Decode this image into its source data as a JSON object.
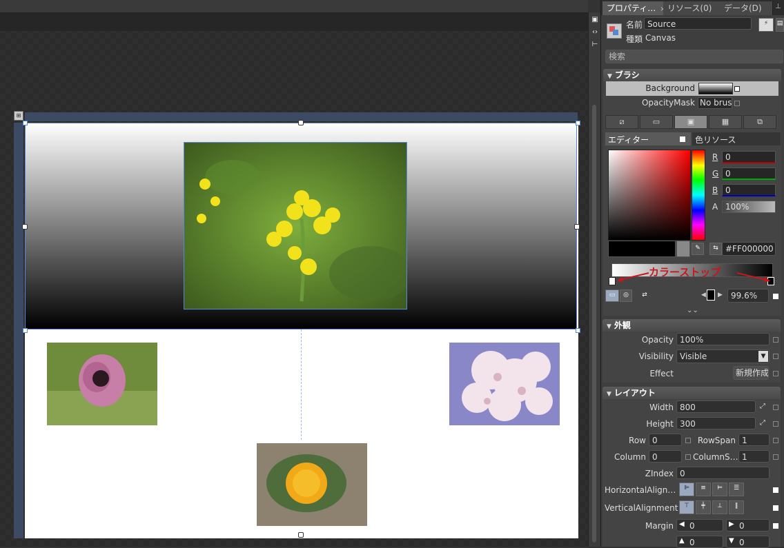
{
  "tabs": [
    {
      "label": "プロパティ…",
      "close": "×",
      "active": true
    },
    {
      "label": "リソース(0)",
      "active": false
    },
    {
      "label": "データ(D)",
      "active": false
    }
  ],
  "element": {
    "name_label": "名前",
    "name_value": "Source",
    "type_label": "種類",
    "type_value": "Canvas"
  },
  "search": {
    "placeholder": "検索"
  },
  "brush": {
    "section_title": "ブラシ",
    "background_label": "Background",
    "opacitymask_label": "OpacityMask",
    "opacitymask_value": "No brush",
    "editor_tab": "エディター",
    "color_resources_tab": "色リソース",
    "r_label": "R",
    "r_value": "0",
    "g_label": "G",
    "g_value": "0",
    "b_label": "B",
    "b_value": "0",
    "a_label": "A",
    "a_value": "100%",
    "hex_value": "#FF000000",
    "stop_offset": "99.6%",
    "annotation": "カラーストップ"
  },
  "appearance": {
    "section_title": "外観",
    "opacity_label": "Opacity",
    "opacity_value": "100%",
    "visibility_label": "Visibility",
    "visibility_value": "Visible",
    "effect_label": "Effect",
    "effect_button": "新規作成"
  },
  "layout": {
    "section_title": "レイアウト",
    "width_label": "Width",
    "width_value": "800",
    "height_label": "Height",
    "height_value": "300",
    "row_label": "Row",
    "row_value": "0",
    "rowspan_label": "RowSpan",
    "rowspan_value": "1",
    "column_label": "Column",
    "column_value": "0",
    "columnspan_label": "ColumnS…",
    "columnspan_value": "1",
    "zindex_label": "ZIndex",
    "zindex_value": "0",
    "halign_label": "HorizontalAlign…",
    "valign_label": "VerticalAlignment",
    "margin_label": "Margin",
    "margin_left": "0",
    "margin_right": "0",
    "margin_top": "0",
    "margin_bottom": "0"
  },
  "colors": {
    "accent": "#5a88d6",
    "annotation": "#c8161d",
    "panel_bg": "#3e3e3e"
  }
}
